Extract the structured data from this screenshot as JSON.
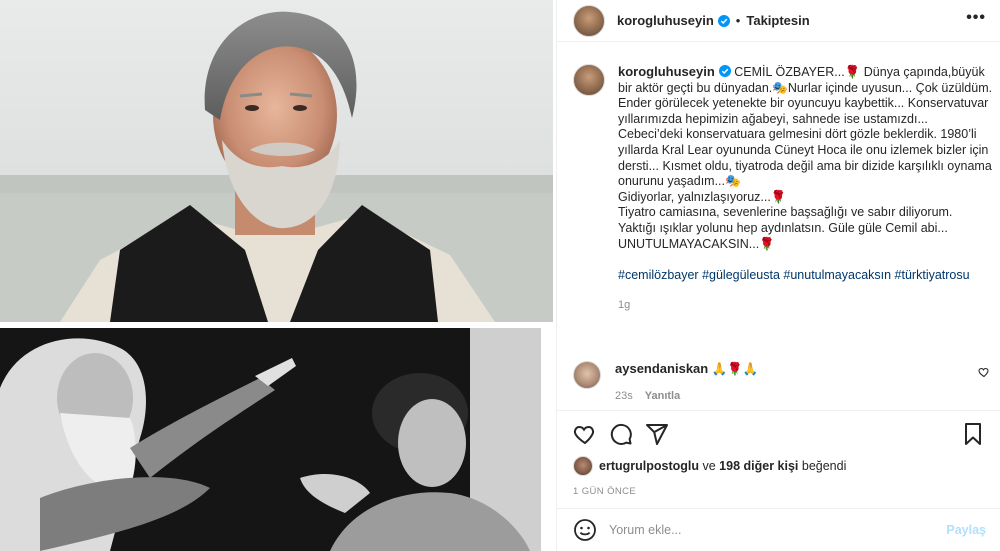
{
  "post": {
    "username": "korogluhuseyin",
    "follow_label": "Takiptesin",
    "dot": "•",
    "more": "•••",
    "caption": {
      "title": "CEMİL ÖZBAYER...🌹",
      "text": "Dünya çapında,büyük bir aktör geçti bu dünyadan.🎭Nurlar içinde uyusun... Çok üzüldüm. Ender görülecek yetenekte bir oyuncuyu kaybettik... Konservatuvar yıllarımızda hepimizin ağabeyi, sahnede ise ustamızdı... Cebeci’deki konservatuara gelmesini dört gözle beklerdik. 1980’li yıllarda Kral Lear oyununda Cüneyt Hoca ile onu izlemek bizler için dersti... Kısmet oldu, tiyatroda değil ama bir dizide karşılıklı oynama onurunu yaşadım...🎭\nGidiyorlar, yalnızlaşıyoruz...🌹\nTiyatro camiasına, sevenlerine başsağlığı ve sabır diliyorum. Yaktığı ışıklar yolunu hep aydınlatsın. Güle güle Cemil abi...\nUNUTULMAYACAKSIN...🌹",
      "hashtags": "#cemilözbayer #gülegüleusta #unutulmayacaksın #türktiyatrosu",
      "time": "1g"
    },
    "comment": {
      "username": "aysendaniskan",
      "text": "🙏🌹🙏",
      "time": "23s",
      "reply_label": "Yanıtla"
    },
    "likes": {
      "user": "ertugrulpostoglu",
      "connector": "ve",
      "others": "198 diğer kişi",
      "suffix": "beğendi"
    },
    "time_ago": "1 GÜN ÖNCE",
    "add_comment": {
      "placeholder": "Yorum ekle...",
      "post_label": "Paylaş"
    }
  },
  "colors": {
    "link": "#00376b",
    "muted": "#8e8e8e",
    "verified": "#0095f6",
    "post_disabled": "#b2dffc",
    "divider": "#efefef"
  },
  "icons": [
    "verified-badge-icon",
    "more-options-icon",
    "heart-icon",
    "comment-icon",
    "share-icon",
    "bookmark-icon",
    "emoji-icon"
  ]
}
